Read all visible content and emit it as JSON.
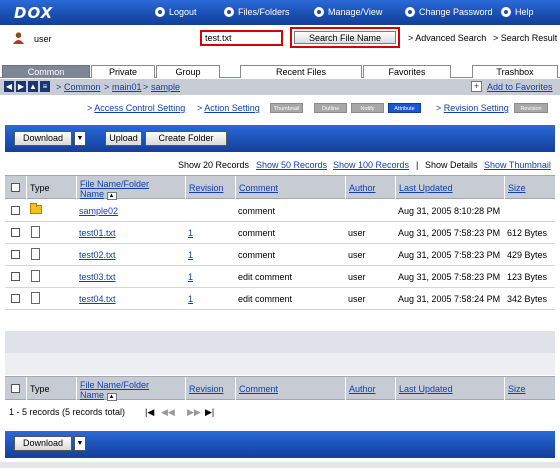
{
  "app": {
    "logo": "DOX"
  },
  "topnav": [
    {
      "label": "Logout"
    },
    {
      "label": "Files/Folders"
    },
    {
      "label": "Manage/View"
    },
    {
      "label": "Change Password"
    },
    {
      "label": "Help"
    }
  ],
  "user": {
    "name": "user"
  },
  "search": {
    "value": "test.txt",
    "button": "Search File Name",
    "advanced": "Advanced Search",
    "result": "Search Result"
  },
  "tabs": [
    "Common",
    "Private",
    "Group",
    "Recent Files",
    "Favorites",
    "Trashbox"
  ],
  "active_tab": "Common",
  "breadcrumb": [
    "Common",
    "main01",
    "sample"
  ],
  "add_favorites": "Add to Favorites",
  "settings": {
    "access": "Access Control Setting",
    "action": "Action Setting",
    "pills": [
      "Thumbnail",
      "Outline",
      "Notify",
      "Attribute"
    ],
    "active_pill": "Attribute",
    "revision": "Revision Setting",
    "revision_pill": "Revision"
  },
  "toolbar": {
    "download": "Download",
    "upload": "Upload",
    "create_folder": "Create Folder"
  },
  "show": {
    "show20": "Show 20 Records",
    "show50": "Show 50 Records",
    "show100": "Show 100 Records",
    "sep": "|",
    "details": "Show Details",
    "thumbnail": "Show Thumbnail"
  },
  "columns": {
    "type": "Type",
    "name_line1": "File Name/Folder",
    "name_line2": "Name",
    "revision": "Revision",
    "comment": "Comment",
    "author": "Author",
    "updated": "Last Updated",
    "size": "Size"
  },
  "rows": [
    {
      "kind": "folder",
      "name": "sample02",
      "revision": "",
      "comment": "comment",
      "author": "",
      "updated": "Aug 31, 2005 8:10:28 PM",
      "size": ""
    },
    {
      "kind": "file",
      "name": "test01.txt",
      "revision": "1",
      "comment": "comment",
      "author": "user",
      "updated": "Aug 31, 2005 7:58:23 PM",
      "size": "612 Bytes"
    },
    {
      "kind": "file",
      "name": "test02.txt",
      "revision": "1",
      "comment": "comment",
      "author": "user",
      "updated": "Aug 31, 2005 7:58:23 PM",
      "size": "429 Bytes"
    },
    {
      "kind": "file",
      "name": "test03.txt",
      "revision": "1",
      "comment": "edit comment",
      "author": "user",
      "updated": "Aug 31, 2005 7:58:23 PM",
      "size": "123 Bytes"
    },
    {
      "kind": "file",
      "name": "test04.txt",
      "revision": "1",
      "comment": "edit comment",
      "author": "user",
      "updated": "Aug 31, 2005 7:58:24 PM",
      "size": "342 Bytes"
    }
  ],
  "pager": {
    "summary": "1 - 5 records (5 records total)"
  },
  "colors": {
    "bar": "#1b4fb3",
    "header": "#c6cbd4",
    "link": "#1040b0",
    "highlight": "#d80000"
  }
}
